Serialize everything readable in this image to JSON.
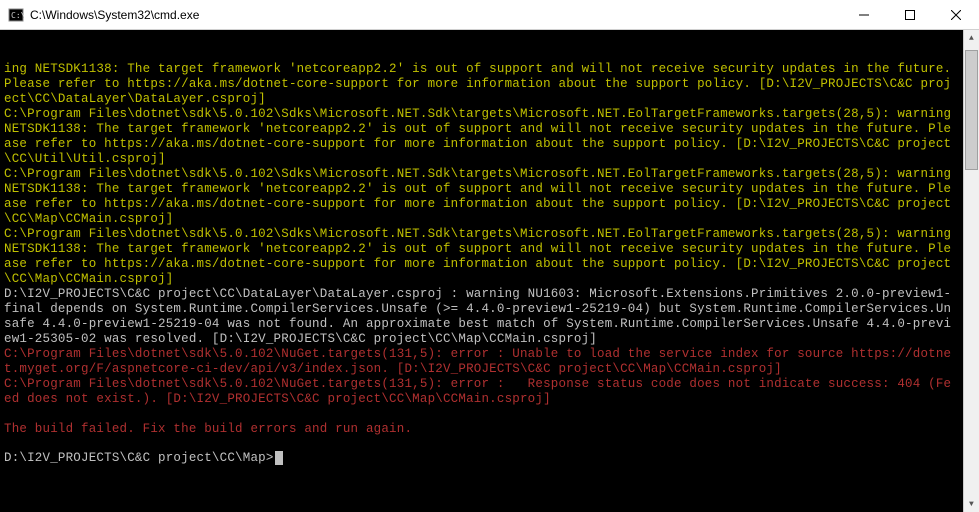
{
  "window": {
    "title": "C:\\Windows\\System32\\cmd.exe"
  },
  "terminal": {
    "lines": [
      {
        "cls": "warn",
        "text": "ing NETSDK1138: The target framework 'netcoreapp2.2' is out of support and will not receive security updates in the future. Please refer to https://aka.ms/dotnet-core-support for more information about the support policy. [D:\\I2V_PROJECTS\\C&C project\\CC\\DataLayer\\DataLayer.csproj]"
      },
      {
        "cls": "warn",
        "text": "C:\\Program Files\\dotnet\\sdk\\5.0.102\\Sdks\\Microsoft.NET.Sdk\\targets\\Microsoft.NET.EolTargetFrameworks.targets(28,5): warning NETSDK1138: The target framework 'netcoreapp2.2' is out of support and will not receive security updates in the future. Please refer to https://aka.ms/dotnet-core-support for more information about the support policy. [D:\\I2V_PROJECTS\\C&C project\\CC\\Util\\Util.csproj]"
      },
      {
        "cls": "warn",
        "text": "C:\\Program Files\\dotnet\\sdk\\5.0.102\\Sdks\\Microsoft.NET.Sdk\\targets\\Microsoft.NET.EolTargetFrameworks.targets(28,5): warning NETSDK1138: The target framework 'netcoreapp2.2' is out of support and will not receive security updates in the future. Please refer to https://aka.ms/dotnet-core-support for more information about the support policy. [D:\\I2V_PROJECTS\\C&C project\\CC\\Map\\CCMain.csproj]"
      },
      {
        "cls": "warn",
        "text": "C:\\Program Files\\dotnet\\sdk\\5.0.102\\Sdks\\Microsoft.NET.Sdk\\targets\\Microsoft.NET.EolTargetFrameworks.targets(28,5): warning NETSDK1138: The target framework 'netcoreapp2.2' is out of support and will not receive security updates in the future. Please refer to https://aka.ms/dotnet-core-support for more information about the support policy. [D:\\I2V_PROJECTS\\C&C project\\CC\\Map\\CCMain.csproj]"
      },
      {
        "cls": "gray",
        "text": "D:\\I2V_PROJECTS\\C&C project\\CC\\DataLayer\\DataLayer.csproj : warning NU1603: Microsoft.Extensions.Primitives 2.0.0-preview1-final depends on System.Runtime.CompilerServices.Unsafe (>= 4.4.0-preview1-25219-04) but System.Runtime.CompilerServices.Unsafe 4.4.0-preview1-25219-04 was not found. An approximate best match of System.Runtime.CompilerServices.Unsafe 4.4.0-preview1-25305-02 was resolved. [D:\\I2V_PROJECTS\\C&C project\\CC\\Map\\CCMain.csproj]"
      },
      {
        "cls": "err",
        "text": "C:\\Program Files\\dotnet\\sdk\\5.0.102\\NuGet.targets(131,5): error : Unable to load the service index for source https://dotnet.myget.org/F/aspnetcore-ci-dev/api/v3/index.json. [D:\\I2V_PROJECTS\\C&C project\\CC\\Map\\CCMain.csproj]"
      },
      {
        "cls": "err",
        "text": "C:\\Program Files\\dotnet\\sdk\\5.0.102\\NuGet.targets(131,5): error :   Response status code does not indicate success: 404 (Feed does not exist.). [D:\\I2V_PROJECTS\\C&C project\\CC\\Map\\CCMain.csproj]"
      },
      {
        "cls": "err",
        "text": ""
      },
      {
        "cls": "err",
        "text": "The build failed. Fix the build errors and run again."
      }
    ],
    "prompt": "D:\\I2V_PROJECTS\\C&C project\\CC\\Map>"
  }
}
